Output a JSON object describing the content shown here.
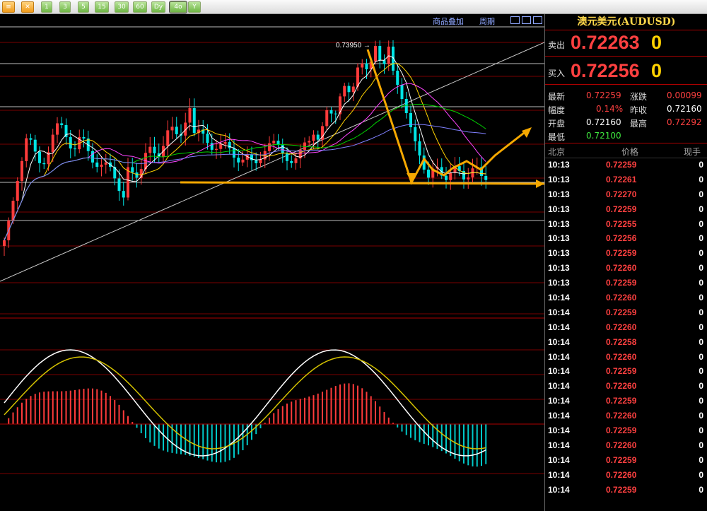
{
  "toolbar": {
    "buttons": [
      "≡",
      "✕",
      "1",
      "3",
      "5",
      "15",
      "30",
      "60",
      "Dy",
      "4o",
      "Y"
    ]
  },
  "chart_header": {
    "overlay_label": "商品叠加",
    "period_label": "周期"
  },
  "chart_data": {
    "type": "candlestick",
    "annotations": [
      "0.73950"
    ],
    "title": "",
    "ylabel": "",
    "xlabel": ""
  },
  "quote": {
    "title": "澳元美元(AUDUSD)",
    "sell_label": "卖出",
    "sell_price": "0.72263",
    "sell_volume": "0",
    "buy_label": "买入",
    "buy_price": "0.72256",
    "buy_volume": "0",
    "stats": {
      "latest_label": "最新",
      "latest": "0.72259",
      "change_label": "涨跌",
      "change": "0.00099",
      "amplitude_label": "幅度",
      "amplitude": "0.14%",
      "prev_close_label": "昨收",
      "prev_close": "0.72160",
      "open_label": "开盘",
      "open": "0.72160",
      "high_label": "最高",
      "high": "0.72292",
      "low_label": "最低",
      "low": "0.72100"
    },
    "tick_headers": {
      "time": "北京",
      "price": "价格",
      "volume": "现手"
    },
    "ticks": [
      {
        "time": "10:13",
        "price": "0.72259",
        "vol": "0"
      },
      {
        "time": "10:13",
        "price": "0.72261",
        "vol": "0"
      },
      {
        "time": "10:13",
        "price": "0.72270",
        "vol": "0"
      },
      {
        "time": "10:13",
        "price": "0.72259",
        "vol": "0"
      },
      {
        "time": "10:13",
        "price": "0.72255",
        "vol": "0"
      },
      {
        "time": "10:13",
        "price": "0.72256",
        "vol": "0"
      },
      {
        "time": "10:13",
        "price": "0.72259",
        "vol": "0"
      },
      {
        "time": "10:13",
        "price": "0.72260",
        "vol": "0"
      },
      {
        "time": "10:13",
        "price": "0.72259",
        "vol": "0"
      },
      {
        "time": "10:14",
        "price": "0.72260",
        "vol": "0"
      },
      {
        "time": "10:14",
        "price": "0.72259",
        "vol": "0"
      },
      {
        "time": "10:14",
        "price": "0.72260",
        "vol": "0"
      },
      {
        "time": "10:14",
        "price": "0.72258",
        "vol": "0"
      },
      {
        "time": "10:14",
        "price": "0.72260",
        "vol": "0"
      },
      {
        "time": "10:14",
        "price": "0.72259",
        "vol": "0"
      },
      {
        "time": "10:14",
        "price": "0.72260",
        "vol": "0"
      },
      {
        "time": "10:14",
        "price": "0.72259",
        "vol": "0"
      },
      {
        "time": "10:14",
        "price": "0.72260",
        "vol": "0"
      },
      {
        "time": "10:14",
        "price": "0.72259",
        "vol": "0"
      },
      {
        "time": "10:14",
        "price": "0.72260",
        "vol": "0"
      },
      {
        "time": "10:14",
        "price": "0.72259",
        "vol": "0"
      },
      {
        "time": "10:14",
        "price": "0.72260",
        "vol": "0"
      },
      {
        "time": "10:14",
        "price": "0.72259",
        "vol": "0"
      }
    ]
  }
}
